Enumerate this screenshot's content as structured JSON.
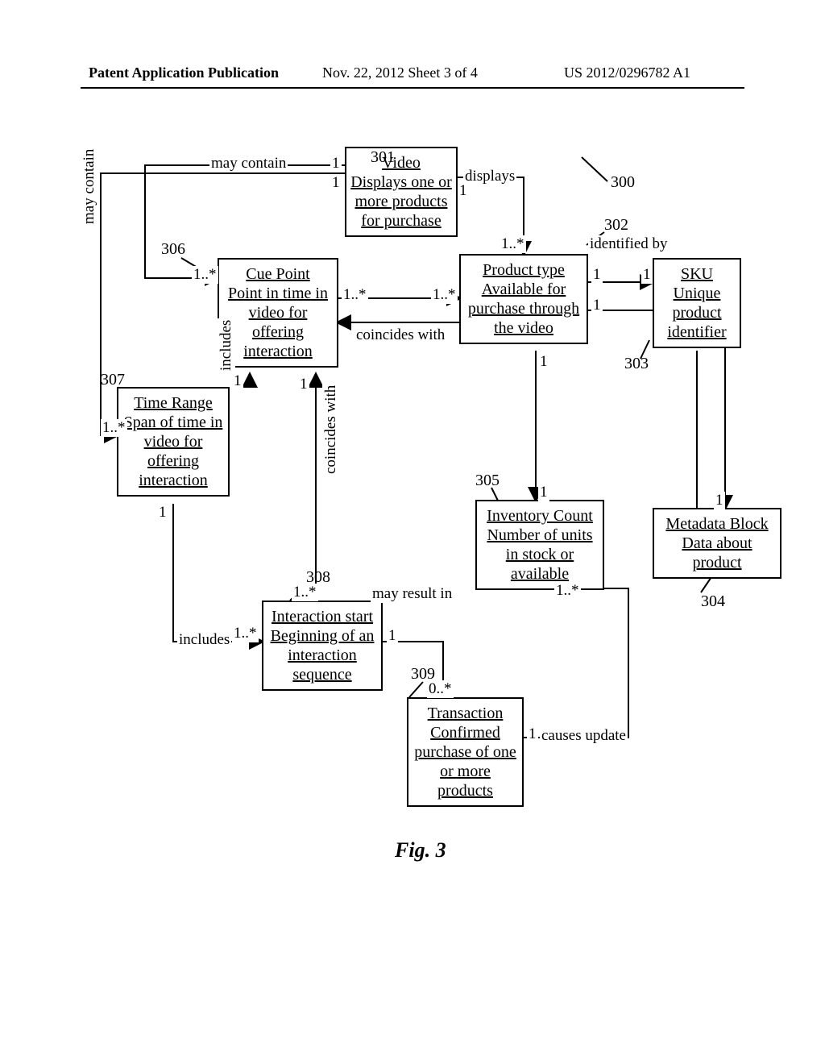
{
  "header": {
    "left": "Patent Application Publication",
    "middle": "Nov. 22, 2012  Sheet 3 of 4",
    "right": "US 2012/0296782 A1"
  },
  "figure": {
    "label": "Fig. 3"
  },
  "boxes": {
    "video": {
      "title": "Video",
      "body": "Displays one or more products for purchase"
    },
    "cue": {
      "title": "Cue Point",
      "body": "Point in time in video for offering interaction"
    },
    "tr": {
      "title": "Time Range",
      "body": "Span of time in video for offering interaction"
    },
    "product": {
      "title": "Product type",
      "body": "Available for purchase through the video"
    },
    "sku": {
      "title": "SKU",
      "body": "Unique product identifier"
    },
    "meta": {
      "title": "Metadata Block",
      "body": "Data about product"
    },
    "inv": {
      "title": "Inventory Count",
      "body": "Number of units in stock or available"
    },
    "is": {
      "title": "Interaction start",
      "body": "Beginning of an interaction sequence"
    },
    "txn": {
      "title": "Transaction",
      "body": "Confirmed purchase of one or more products"
    }
  },
  "edges": {
    "video_cue": {
      "label": "may contain",
      "m1": "1",
      "m2": "1..*"
    },
    "video_tr": {
      "label": "may contain",
      "m1": "1",
      "m2": "1..*"
    },
    "video_prod": {
      "label": "displays",
      "m1": "1",
      "m2": "1..*"
    },
    "prod_sku": {
      "label": "identified by",
      "m1": "1",
      "m2": "1"
    },
    "prod_meta": {
      "label": "",
      "m1": "1",
      "m2": "1"
    },
    "prod_inv": {
      "label": "",
      "m1": "1",
      "m2": "1"
    },
    "cue_prod": {
      "label": "coincides with",
      "m1": "1..*",
      "m2": "1..*"
    },
    "tr_cue": {
      "label": "includes",
      "m1": "1",
      "m2": ""
    },
    "tr_is": {
      "label": "includes",
      "m1": "1",
      "m2": "1..*"
    },
    "is_cue": {
      "label": "coincides with",
      "m1": "1..*",
      "m2": "1"
    },
    "is_txn": {
      "label": "may result in",
      "m1": "1",
      "m2": "0..*"
    },
    "txn_inv": {
      "label": "causes update",
      "m1": "1",
      "m2": "1..*"
    }
  },
  "refs": {
    "r300": "300",
    "r301": "301",
    "r302": "302",
    "r303": "303",
    "r304": "304",
    "r305": "305",
    "r306": "306",
    "r307": "307",
    "r308": "308",
    "r309": "309"
  }
}
